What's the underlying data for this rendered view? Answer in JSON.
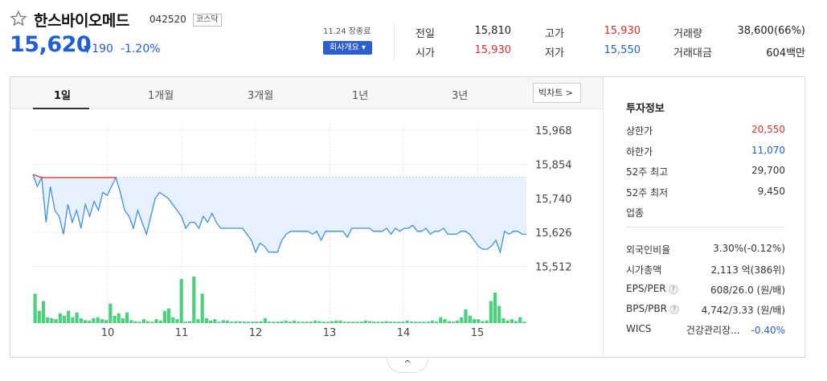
{
  "stock": {
    "name": "한스바이오메드",
    "code": "042520",
    "market": "코스닥",
    "price": "15,620",
    "change_arrow": "▼",
    "change": "190",
    "change_pct": "-1.20%",
    "asof": "11.24 장종료",
    "company_button": "회사개요 ▾"
  },
  "quote": {
    "prev_close_label": "전일",
    "prev_close": "15,810",
    "open_label": "시가",
    "open": "15,930",
    "high_label": "고가",
    "high": "15,930",
    "low_label": "저가",
    "low": "15,550",
    "volume_label": "거래량",
    "volume": "38,600(66%)",
    "value_label": "거래대금",
    "value": "604백만"
  },
  "tabs": [
    "1일",
    "1개월",
    "3개월",
    "1년",
    "3년"
  ],
  "big_chart_label": "빅차트 >",
  "side": {
    "title": "투자정보",
    "rows1": [
      {
        "label": "상한가",
        "value": "20,550",
        "color": "#e52a2a"
      },
      {
        "label": "하한가",
        "value": "11,070",
        "color": "#1f5fd6"
      },
      {
        "label": "52주 최고",
        "value": "29,700",
        "color": "#333333"
      },
      {
        "label": "52주 최저",
        "value": "9,450",
        "color": "#333333"
      },
      {
        "label": "업종",
        "value": "",
        "color": "#333333"
      }
    ],
    "rows2": [
      {
        "label": "외국인비율",
        "value": "3.30%(-0.12%)"
      },
      {
        "label": "시가총액",
        "value": "2,113 억(386위)"
      },
      {
        "label": "EPS/PER",
        "value": "608/26.0 (원/배)"
      },
      {
        "label": "BPS/PBR",
        "value": "4,742/3.33 (원/배)"
      },
      {
        "label": "WICS",
        "value": "건강관리장...",
        "extra": "-0.40%"
      }
    ]
  },
  "collapse_icon": "^",
  "chart_data": {
    "type": "line",
    "x": [
      "10",
      "11",
      "12",
      "13",
      "14",
      "15"
    ],
    "y_ticks": [
      15968,
      15854,
      15740,
      15626,
      15512
    ],
    "ylim": [
      15500,
      15990
    ],
    "prev_close_line": 15810,
    "colors": {
      "line": "#3f8ee6",
      "fill": "#e6f1fd",
      "up": "#e52a2a",
      "volume": "#49d27a"
    },
    "series": [
      {
        "values": [
          15820,
          15780,
          15810,
          15660,
          15780,
          15700,
          15680,
          15620,
          15720,
          15660,
          15700,
          15640,
          15720,
          15680,
          15730,
          15700,
          15760,
          15750,
          15780,
          15810,
          15760,
          15700,
          15680,
          15640,
          15700,
          15660,
          15620,
          15680,
          15740,
          15760,
          15750,
          15740,
          15720,
          15700,
          15680,
          15640,
          15660,
          15660,
          15640,
          15680,
          15660,
          15690,
          15660,
          15640,
          15640,
          15640,
          15640,
          15640,
          15640,
          15620,
          15600,
          15560,
          15590,
          15580,
          15560,
          15560,
          15560,
          15600,
          15620,
          15630,
          15630,
          15630,
          15630,
          15630,
          15620,
          15630,
          15600,
          15630,
          15630,
          15630,
          15630,
          15630,
          15610,
          15640,
          15640,
          15640,
          15640,
          15640,
          15630,
          15630,
          15630,
          15640,
          15620,
          15640,
          15630,
          15640,
          15640,
          15650,
          15630,
          15630,
          15640,
          15620,
          15630,
          15630,
          15640,
          15620,
          15620,
          15620,
          15630,
          15630,
          15620,
          15600,
          15580,
          15570,
          15570,
          15580,
          15600,
          15560,
          15630,
          15620,
          15630,
          15630,
          15620,
          15620
        ]
      }
    ],
    "volume": [
      60,
      25,
      45,
      12,
      10,
      8,
      20,
      15,
      25,
      12,
      22,
      10,
      6,
      5,
      10,
      12,
      8,
      6,
      40,
      15,
      20,
      10,
      22,
      6,
      4,
      3,
      8,
      4,
      3,
      8,
      5,
      25,
      30,
      12,
      8,
      90,
      3,
      4,
      95,
      8,
      60,
      10,
      5,
      8,
      3,
      6,
      5,
      3,
      4,
      4,
      3,
      3,
      3,
      3,
      4,
      10,
      3,
      3,
      3,
      4,
      5,
      3,
      5,
      3,
      3,
      3,
      3,
      5,
      4,
      3,
      3,
      4,
      5,
      5,
      3,
      3,
      3,
      3,
      3,
      5,
      4,
      3,
      3,
      3,
      4,
      3,
      3,
      3,
      3,
      5,
      3,
      3,
      3,
      3,
      3,
      5,
      3,
      12,
      8,
      4,
      3,
      5,
      12,
      28,
      15,
      8,
      8,
      4,
      5,
      45,
      62,
      35,
      10,
      5,
      8,
      4,
      12,
      3
    ]
  }
}
